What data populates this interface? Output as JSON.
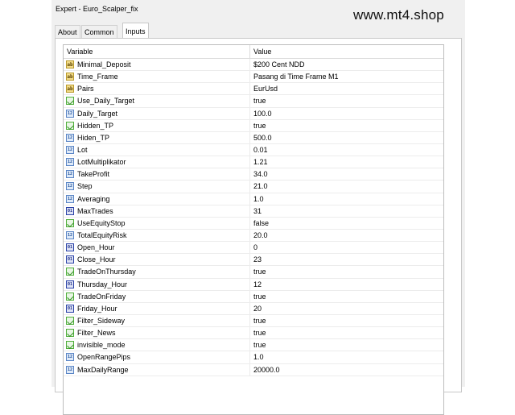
{
  "window": {
    "title": "Expert - Euro_Scalper_fix",
    "watermark": "www.mt4.shop"
  },
  "tabs": [
    {
      "label": "About",
      "active": false
    },
    {
      "label": "Common",
      "active": false
    },
    {
      "label": "Inputs",
      "active": true
    }
  ],
  "grid": {
    "header": {
      "variable": "Variable",
      "value": "Value"
    },
    "rows": [
      {
        "type": "string",
        "icon": "ab-string-icon",
        "name": "Minimal_Deposit",
        "value": "$200 Cent NDD"
      },
      {
        "type": "string",
        "icon": "ab-string-icon",
        "name": "Time_Frame",
        "value": "Pasang di Time Frame M1"
      },
      {
        "type": "string",
        "icon": "ab-string-icon",
        "name": "Pairs",
        "value": "EurUsd"
      },
      {
        "type": "bool",
        "icon": "bool-icon",
        "name": "Use_Daily_Target",
        "value": "true"
      },
      {
        "type": "double",
        "icon": "double-icon",
        "name": "Daily_Target",
        "value": "100.0"
      },
      {
        "type": "bool",
        "icon": "bool-icon",
        "name": "Hidden_TP",
        "value": "true"
      },
      {
        "type": "double",
        "icon": "double-icon",
        "name": "Hiden_TP",
        "value": "500.0"
      },
      {
        "type": "double",
        "icon": "double-icon",
        "name": "Lot",
        "value": "0.01"
      },
      {
        "type": "double",
        "icon": "double-icon",
        "name": "LotMultiplikator",
        "value": "1.21"
      },
      {
        "type": "double",
        "icon": "double-icon",
        "name": "TakeProfit",
        "value": "34.0"
      },
      {
        "type": "double",
        "icon": "double-icon",
        "name": "Step",
        "value": "21.0"
      },
      {
        "type": "double",
        "icon": "double-icon",
        "name": "Averaging",
        "value": "1.0"
      },
      {
        "type": "int",
        "icon": "int-icon",
        "name": "MaxTrades",
        "value": "31"
      },
      {
        "type": "bool",
        "icon": "bool-icon",
        "name": "UseEquityStop",
        "value": "false"
      },
      {
        "type": "double",
        "icon": "double-icon",
        "name": "TotalEquityRisk",
        "value": "20.0"
      },
      {
        "type": "int",
        "icon": "int-icon",
        "name": "Open_Hour",
        "value": "0"
      },
      {
        "type": "int",
        "icon": "int-icon",
        "name": "Close_Hour",
        "value": "23"
      },
      {
        "type": "bool",
        "icon": "bool-icon",
        "name": "TradeOnThursday",
        "value": "true"
      },
      {
        "type": "int",
        "icon": "int-icon",
        "name": "Thursday_Hour",
        "value": "12"
      },
      {
        "type": "bool",
        "icon": "bool-icon",
        "name": "TradeOnFriday",
        "value": "true"
      },
      {
        "type": "int",
        "icon": "int-icon",
        "name": "Friday_Hour",
        "value": "20"
      },
      {
        "type": "bool",
        "icon": "bool-icon",
        "name": "Filter_Sideway",
        "value": "true"
      },
      {
        "type": "bool",
        "icon": "bool-icon",
        "name": "Filter_News",
        "value": "true"
      },
      {
        "type": "bool",
        "icon": "bool-icon",
        "name": "invisible_mode",
        "value": "true"
      },
      {
        "type": "double",
        "icon": "double-icon",
        "name": "OpenRangePips",
        "value": "1.0"
      },
      {
        "type": "double",
        "icon": "double-icon",
        "name": "MaxDailyRange",
        "value": "20000.0"
      }
    ]
  },
  "colors": {
    "window_bg": "#f0f0f0",
    "grid_bg": "#ffffff",
    "string_icon": "#f3dc8a",
    "bool_icon": "#4fae3a",
    "double_icon": "#5b86c6",
    "int_icon": "#2c44a8"
  }
}
